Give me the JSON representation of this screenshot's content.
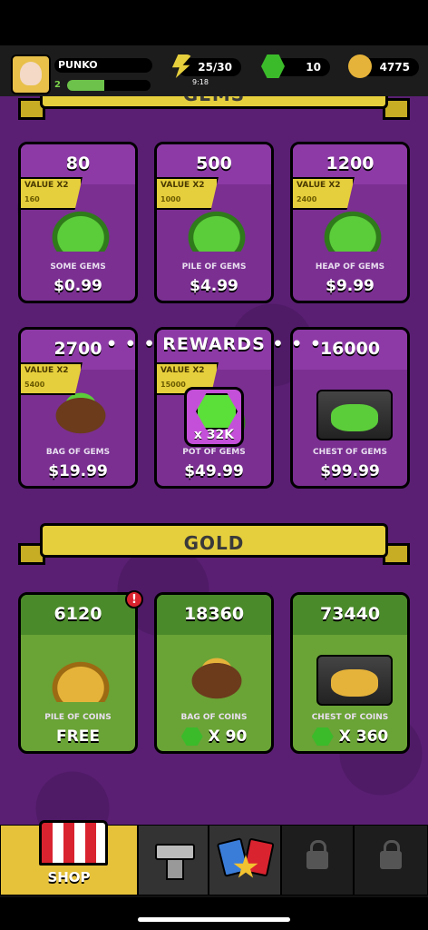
{
  "player": {
    "name": "PUNKO",
    "level": "2",
    "xp_fraction": 0.45
  },
  "stats": {
    "energy": "25/30",
    "energy_timer": "9:18",
    "gems": "10",
    "coins": "4775"
  },
  "sections": {
    "gems_title": "GEMS",
    "gold_title": "GOLD"
  },
  "gem_packs": [
    {
      "amount": "80",
      "name": "SOME GEMS",
      "price": "$0.99",
      "value_label": "VALUE X2",
      "value_amount": "160"
    },
    {
      "amount": "500",
      "name": "PILE OF GEMS",
      "price": "$4.99",
      "value_label": "VALUE X2",
      "value_amount": "1000"
    },
    {
      "amount": "1200",
      "name": "HEAP OF GEMS",
      "price": "$9.99",
      "value_label": "VALUE X2",
      "value_amount": "2400"
    },
    {
      "amount": "2700",
      "name": "BAG OF GEMS",
      "price": "$19.99",
      "value_label": "VALUE X2",
      "value_amount": "5400"
    },
    {
      "amount": "",
      "name": "POT OF GEMS",
      "price": "$49.99",
      "value_label": "VALUE X2",
      "value_amount": "15000"
    },
    {
      "amount": "16000",
      "name": "CHEST OF GEMS",
      "price": "$99.99"
    }
  ],
  "gold_packs": [
    {
      "amount": "6120",
      "name": "PILE OF COINS",
      "price": "FREE"
    },
    {
      "amount": "18360",
      "name": "BAG OF COINS",
      "price": "X 90"
    },
    {
      "amount": "73440",
      "name": "CHEST OF COINS",
      "price": "X 360"
    }
  ],
  "rewards": {
    "title": "• • • REWARDS • • •",
    "count": "x 32K"
  },
  "alert_badge": "!",
  "tabs": [
    {
      "label": "SHOP",
      "icon": "shop-icon",
      "active": true
    },
    {
      "label": "",
      "icon": "anvil-icon"
    },
    {
      "label": "",
      "icon": "cards-icon"
    },
    {
      "label": "",
      "icon": "lock-icon"
    },
    {
      "label": "",
      "icon": "lock-icon"
    }
  ],
  "colors": {
    "background": "#5a1f73",
    "banner": "#e6cf3c",
    "gem_card": "#7a2f91",
    "gold_card": "#6aa336",
    "gem_green": "#5bcc3a",
    "coin_gold": "#e6b33a"
  }
}
